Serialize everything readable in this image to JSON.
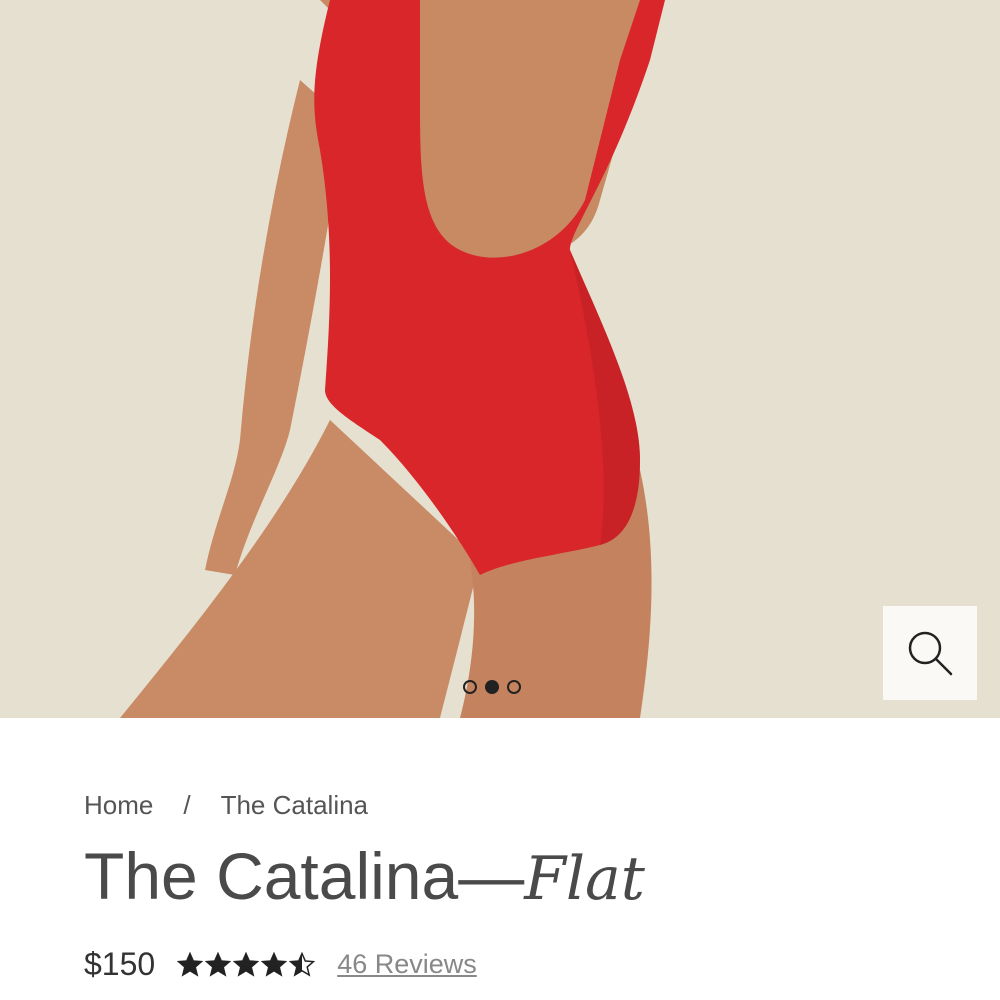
{
  "gallery": {
    "slide_count": 3,
    "active_slide": 2,
    "zoom_icon": "search-icon"
  },
  "breadcrumb": {
    "home": "Home",
    "separator": "/",
    "current": "The Catalina"
  },
  "product": {
    "name": "The Catalina—",
    "variant": "Flat",
    "price": "$150",
    "rating": 4.5,
    "rating_max": 5,
    "reviews_link": "46 Reviews"
  },
  "colors": {
    "swimsuit_red": "#d8262a",
    "background": "#e6e0d0",
    "star": "#222222"
  }
}
